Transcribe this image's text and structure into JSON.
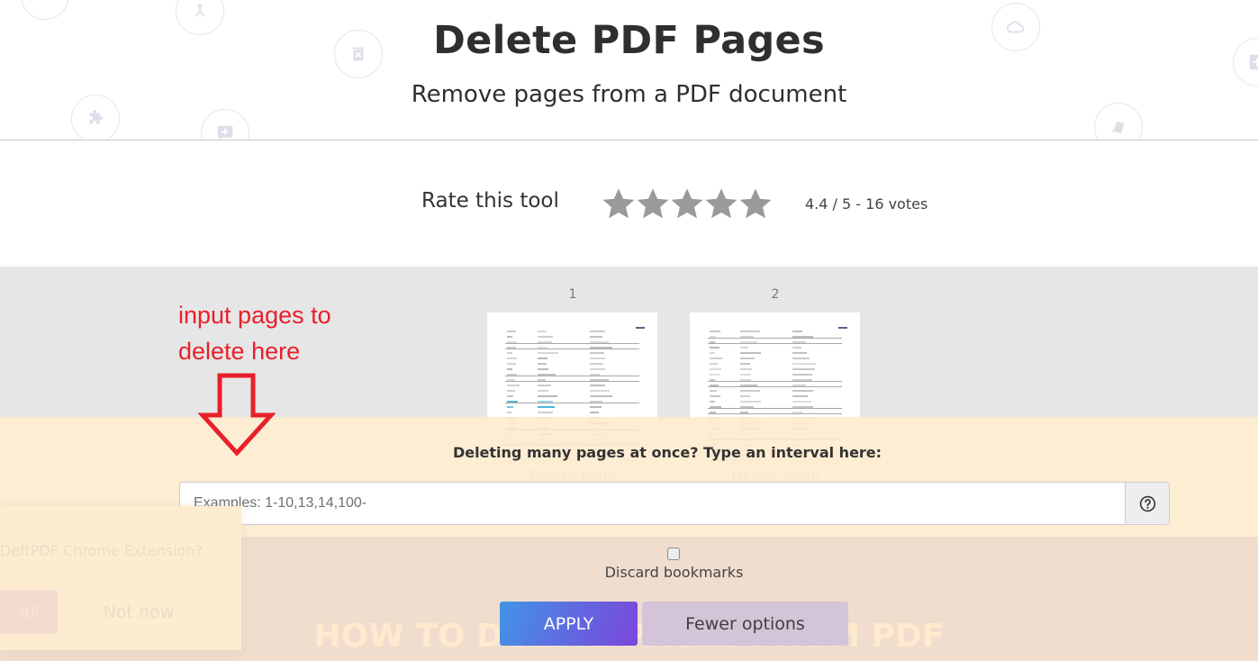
{
  "header": {
    "title": "Delete PDF Pages",
    "subtitle": "Remove pages from a PDF document",
    "background_icons": [
      "compress-icon",
      "merge-icon",
      "delete-icon",
      "puzzle-icon",
      "add-comment-icon",
      "cloud-icon",
      "add-page-icon",
      "rotate-pages-icon"
    ]
  },
  "rating": {
    "label": "Rate this tool",
    "stars": 5,
    "score": 4.4,
    "max": 5,
    "votes_text": "4.4 / 5 - 16 votes",
    "star_color": "#9a9a9a"
  },
  "pages": [
    {
      "number": "1",
      "delete_label": "Delete page"
    },
    {
      "number": "2",
      "delete_label": "Delete page"
    }
  ],
  "annotation": {
    "line1": "input pages to",
    "line2": "delete here",
    "color": "#e8202a"
  },
  "interval": {
    "label": "Deleting many pages at once? Type an interval here:",
    "value": "",
    "placeholder": "Examples: 1-10,13,14,100-",
    "help_icon": "question-circle-icon"
  },
  "options": {
    "discard_bookmarks_label": "Discard bookmarks",
    "discard_bookmarks_checked": false
  },
  "actions": {
    "apply_label": "APPLY",
    "fewer_options_label": "Fewer options"
  },
  "howto_heading": "HOW TO DELETE PAGES FROM PDF",
  "extension_popup": {
    "text": "DeftPDF Chrome Extension?",
    "install_label": "all",
    "not_now_label": "Not now"
  }
}
